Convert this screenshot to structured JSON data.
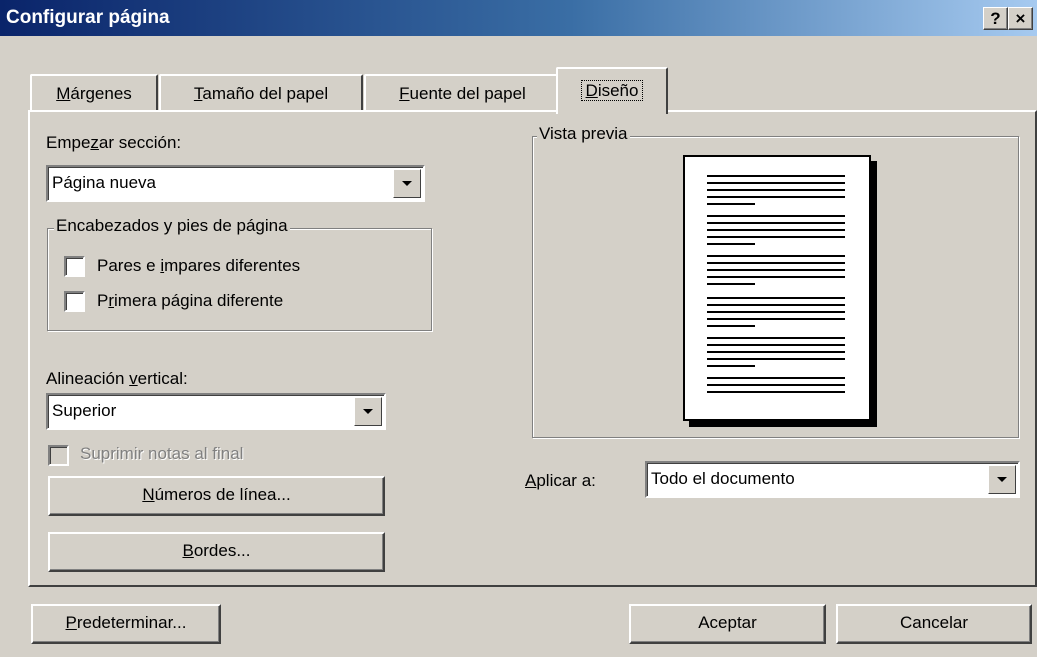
{
  "window": {
    "title": "Configurar página",
    "help_btn": "?",
    "close_btn": "×"
  },
  "tabs": [
    {
      "pre": "",
      "key": "M",
      "post": "árgenes"
    },
    {
      "pre": "",
      "key": "T",
      "post": "amaño del papel"
    },
    {
      "pre": "",
      "key": "F",
      "post": "uente del papel"
    },
    {
      "pre": "",
      "key": "D",
      "post": "iseño"
    }
  ],
  "section": {
    "label_pre": "Empe",
    "label_key": "z",
    "label_post": "ar sección:",
    "value": "Página nueva"
  },
  "headers": {
    "legend": "Encabezados y pies de página",
    "cb1": {
      "pre": "Pares e ",
      "key": "i",
      "post": "mpares diferentes"
    },
    "cb2": {
      "pre": "P",
      "key": "r",
      "post": "imera página diferente"
    }
  },
  "valign": {
    "label_pre": "Alineación ",
    "label_key": "v",
    "label_post": "ertical:",
    "value": "Superior"
  },
  "suppress": "Suprimir notas al final",
  "line_numbers": {
    "key": "N",
    "post": "úmeros de línea..."
  },
  "borders": {
    "key": "B",
    "post": "ordes..."
  },
  "preview": {
    "legend": "Vista previa"
  },
  "apply": {
    "label_key": "A",
    "label_post": "plicar a:",
    "value": "Todo el documento"
  },
  "buttons": {
    "default": {
      "key": "P",
      "post": "redeterminar..."
    },
    "ok": "Aceptar",
    "cancel": "Cancelar"
  },
  "icons": {
    "dropdown": "chevron-down-icon"
  }
}
